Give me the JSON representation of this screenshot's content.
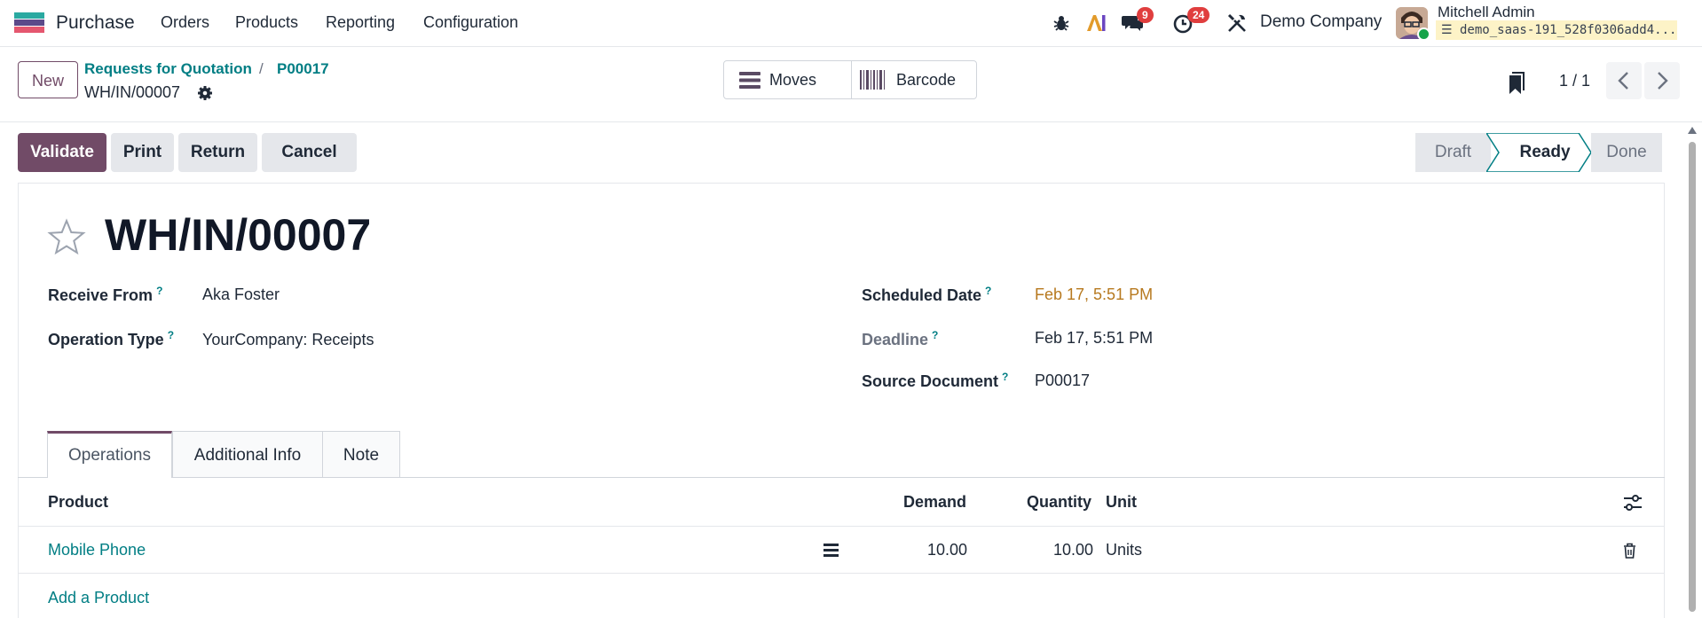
{
  "topbar": {
    "app_name": "Purchase",
    "menu": [
      "Orders",
      "Products",
      "Reporting",
      "Configuration"
    ],
    "messages_count": "9",
    "activities_count": "24",
    "company": "Demo Company",
    "user_name": "Mitchell Admin",
    "database": "demo_saas-191_528f0306add4...",
    "icons": [
      "bug-icon",
      "ai-icon",
      "chat-icon",
      "clock-icon",
      "tools-icon"
    ]
  },
  "control": {
    "new_label": "New",
    "breadcrumb": [
      "Requests for Quotation",
      "P00017"
    ],
    "breadcrumb_sep": "/",
    "record": "WH/IN/00007",
    "smart_buttons": [
      "Moves",
      "Barcode"
    ],
    "pager": "1 / 1"
  },
  "actions": {
    "validate": "Validate",
    "print": "Print",
    "return": "Return",
    "cancel": "Cancel"
  },
  "status": {
    "stages": [
      "Draft",
      "Ready",
      "Done"
    ],
    "current": "Ready"
  },
  "form": {
    "title": "WH/IN/00007",
    "receive_from_label": "Receive From",
    "receive_from": "Aka Foster",
    "operation_type_label": "Operation Type",
    "operation_type": "YourCompany: Receipts",
    "scheduled_date_label": "Scheduled Date",
    "scheduled_date": "Feb 17, 5:51 PM",
    "deadline_label": "Deadline",
    "deadline": "Feb 17, 5:51 PM",
    "source_document_label": "Source Document",
    "source_document": "P00017",
    "help_mark": "?"
  },
  "tabs": [
    "Operations",
    "Additional Info",
    "Note"
  ],
  "table": {
    "headers": {
      "product": "Product",
      "demand": "Demand",
      "quantity": "Quantity",
      "unit": "Unit"
    },
    "rows": [
      {
        "product": "Mobile Phone",
        "demand": "10.00",
        "quantity": "10.00",
        "unit": "Units"
      }
    ],
    "add_product": "Add a Product"
  },
  "colors": {
    "brand": "#714b67",
    "link": "#017e84",
    "warning_date": "#b7791f",
    "badge": "#e03e3e"
  }
}
